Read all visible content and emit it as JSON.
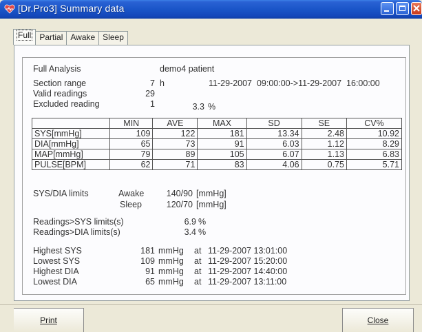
{
  "window": {
    "title": "[Dr.Pro3] Summary data"
  },
  "tabs": [
    {
      "label": "Full"
    },
    {
      "label": "Partial"
    },
    {
      "label": "Awake"
    },
    {
      "label": "Sleep"
    }
  ],
  "analysis": {
    "type_label": "Full Analysis",
    "patient": "demo4 patient",
    "section_range_label": "Section range",
    "section_range_value": "7",
    "section_range_unit": "h",
    "section_range_span": "11-29-2007  09:00:00->11-29-2007  16:00:00",
    "valid_readings_label": "Valid readings",
    "valid_readings_value": "29",
    "excluded_label": "Excluded reading",
    "excluded_value": "1",
    "excluded_pct": "3.3",
    "pct_unit": "%"
  },
  "stats_table": {
    "headers": [
      "",
      "MIN",
      "AVE",
      "MAX",
      "SD",
      "SE",
      "CV%"
    ],
    "rows": [
      {
        "label": "SYS[mmHg]",
        "values": [
          "109",
          "122",
          "181",
          "13.34",
          "2.48",
          "10.92"
        ]
      },
      {
        "label": "DIA[mmHg]",
        "values": [
          "65",
          "73",
          "91",
          "6.03",
          "1.12",
          "8.29"
        ]
      },
      {
        "label": "MAP[mmHg]",
        "values": [
          "79",
          "89",
          "105",
          "6.07",
          "1.13",
          "6.83"
        ]
      },
      {
        "label": "PULSE[BPM]",
        "values": [
          "62",
          "71",
          "83",
          "4.06",
          "0.75",
          "5.71"
        ]
      }
    ]
  },
  "limits": {
    "label": "SYS/DIA limits",
    "awake_label": "Awake",
    "awake_value": "140/90",
    "sleep_label": "Sleep",
    "sleep_value": "120/70",
    "unit": "[mmHg]"
  },
  "readings_over": {
    "sys_label": "Readings>SYS limits(s)",
    "sys_value": "6.9",
    "dia_label": "Readings>DIA limits(s)",
    "dia_value": "3.4",
    "unit": "%"
  },
  "extremes": {
    "at": "at",
    "unit": "mmHg",
    "rows": [
      {
        "label": "Highest SYS",
        "value": "181",
        "time": "11-29-2007 13:01:00"
      },
      {
        "label": "Lowest SYS",
        "value": "109",
        "time": "11-29-2007 15:20:00"
      },
      {
        "label": "Highest DIA",
        "value": "91",
        "time": "11-29-2007 14:40:00"
      },
      {
        "label": "Lowest DIA",
        "value": "65",
        "time": "11-29-2007 13:11:00"
      }
    ]
  },
  "buttons": {
    "print_label": "Print",
    "close_label": "Close"
  },
  "colors": {
    "titlebar": "#1a55c8",
    "window_bg": "#ece9d8",
    "close_button": "#c9381a"
  }
}
